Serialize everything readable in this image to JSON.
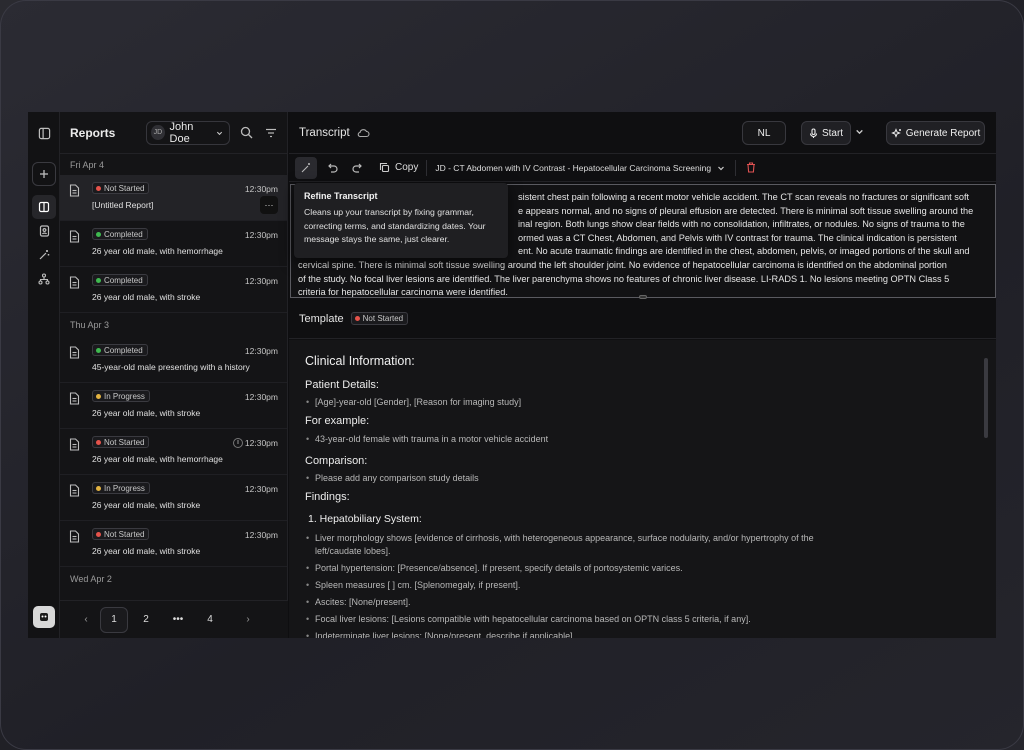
{
  "sidebar": {
    "title": "Reports",
    "user_initials": "JD",
    "user_name": "John Doe",
    "date_groups": [
      {
        "label": "Fri Apr 4"
      },
      {
        "label": "Thu Apr 3"
      },
      {
        "label": "Wed Apr 2"
      }
    ],
    "items": [
      {
        "status": "Not Started",
        "time": "12:30pm",
        "title": "[Untitled Report]"
      },
      {
        "status": "Completed",
        "time": "12:30pm",
        "title": "26 year old male, with hemorrhage"
      },
      {
        "status": "Completed",
        "time": "12:30pm",
        "title": "26 year old male, with stroke"
      },
      {
        "status": "Completed",
        "time": "12:30pm",
        "title": "45-year-old male presenting with a history"
      },
      {
        "status": "In Progress",
        "time": "12:30pm",
        "title": "26 year old male, with stroke"
      },
      {
        "status": "Not Started",
        "time": "12:30pm",
        "title": "26 year old male, with hemorrhage"
      },
      {
        "status": "In Progress",
        "time": "12:30pm",
        "title": "26 year old male, with stroke"
      },
      {
        "status": "Not Started",
        "time": "12:30pm",
        "title": "26 year old male, with stroke"
      }
    ],
    "more_label": "···",
    "pagination": {
      "pages": [
        "1",
        "2",
        "•••",
        "4"
      ],
      "current": "1"
    }
  },
  "status_colors": {
    "Not Started": "#e5534b",
    "Completed": "#3fb950",
    "In Progress": "#e3b341"
  },
  "topbar": {
    "title": "Transcript",
    "lang_button": "NL",
    "start_button": "Start",
    "generate_button": "Generate Report"
  },
  "toolbar": {
    "copy_label": "Copy",
    "template_name": "JD - CT Abdomen with IV Contrast - Hepatocellular Carcinoma Screening"
  },
  "tooltip": {
    "title": "Refine Transcript",
    "body": "Cleans up your transcript by fixing grammar, correcting terms, and standardizing dates. Your message stays the same, just clearer."
  },
  "transcript": {
    "line1": "sistent chest pain following a recent motor vehicle accident. The CT scan reveals no fractures or significant soft",
    "line2": "e appears normal, and no signs of pleural effusion are detected. There is minimal soft tissue swelling around the",
    "line3": "inal region. Both lungs show clear fields with no consolidation, infiltrates, or nodules. No signs of trauma to the",
    "line4": "ormed was a CT Chest, Abdomen, and Pelvis with IV contrast for trauma. The clinical indication is persistent",
    "line5": "ent. No acute traumatic findings are identified in the chest, abdomen, pelvis, or imaged portions of the skull and",
    "line6": "cervical spine. There is minimal soft tissue swelling around the left shoulder joint. No evidence of hepatocellular carcinoma is identified on the abdominal portion",
    "line7": "of the study. No focal liver lesions are identified. The liver parenchyma shows no features of chronic liver disease. LI-RADS 1. No lesions meeting OPTN Class 5",
    "line8": "criteria for hepatocellular carcinoma were identified."
  },
  "template": {
    "title": "Template",
    "status": "Not Started",
    "heading": "Clinical Information:",
    "patient_details_h": "Patient Details:",
    "patient_details": "[Age]-year-old [Gender], [Reason for imaging study]",
    "example_h": "For example:",
    "example": "43-year-old female with trauma in a motor vehicle accident",
    "comparison_h": "Comparison:",
    "comparison": "Please add any comparison study details",
    "findings_h": "Findings:",
    "hepatobiliary_h": "1. Hepatobiliary System:",
    "findings": [
      "Liver morphology shows [evidence of cirrhosis, with heterogeneous appearance, surface nodularity, and/or hypertrophy of the left/caudate lobes].",
      "Portal hypertension: [Presence/absence]. If present, specify details of portosystemic varices.",
      "Spleen measures [ ] cm. [Splenomegaly, if present].",
      "Ascites: [None/present].",
      "Focal liver lesions: [Lesions compatible with hepatocellular carcinoma based on OPTN class 5 criteria, if any].",
      "Indeterminate liver lesions: [None/present, describe if applicable]."
    ]
  }
}
